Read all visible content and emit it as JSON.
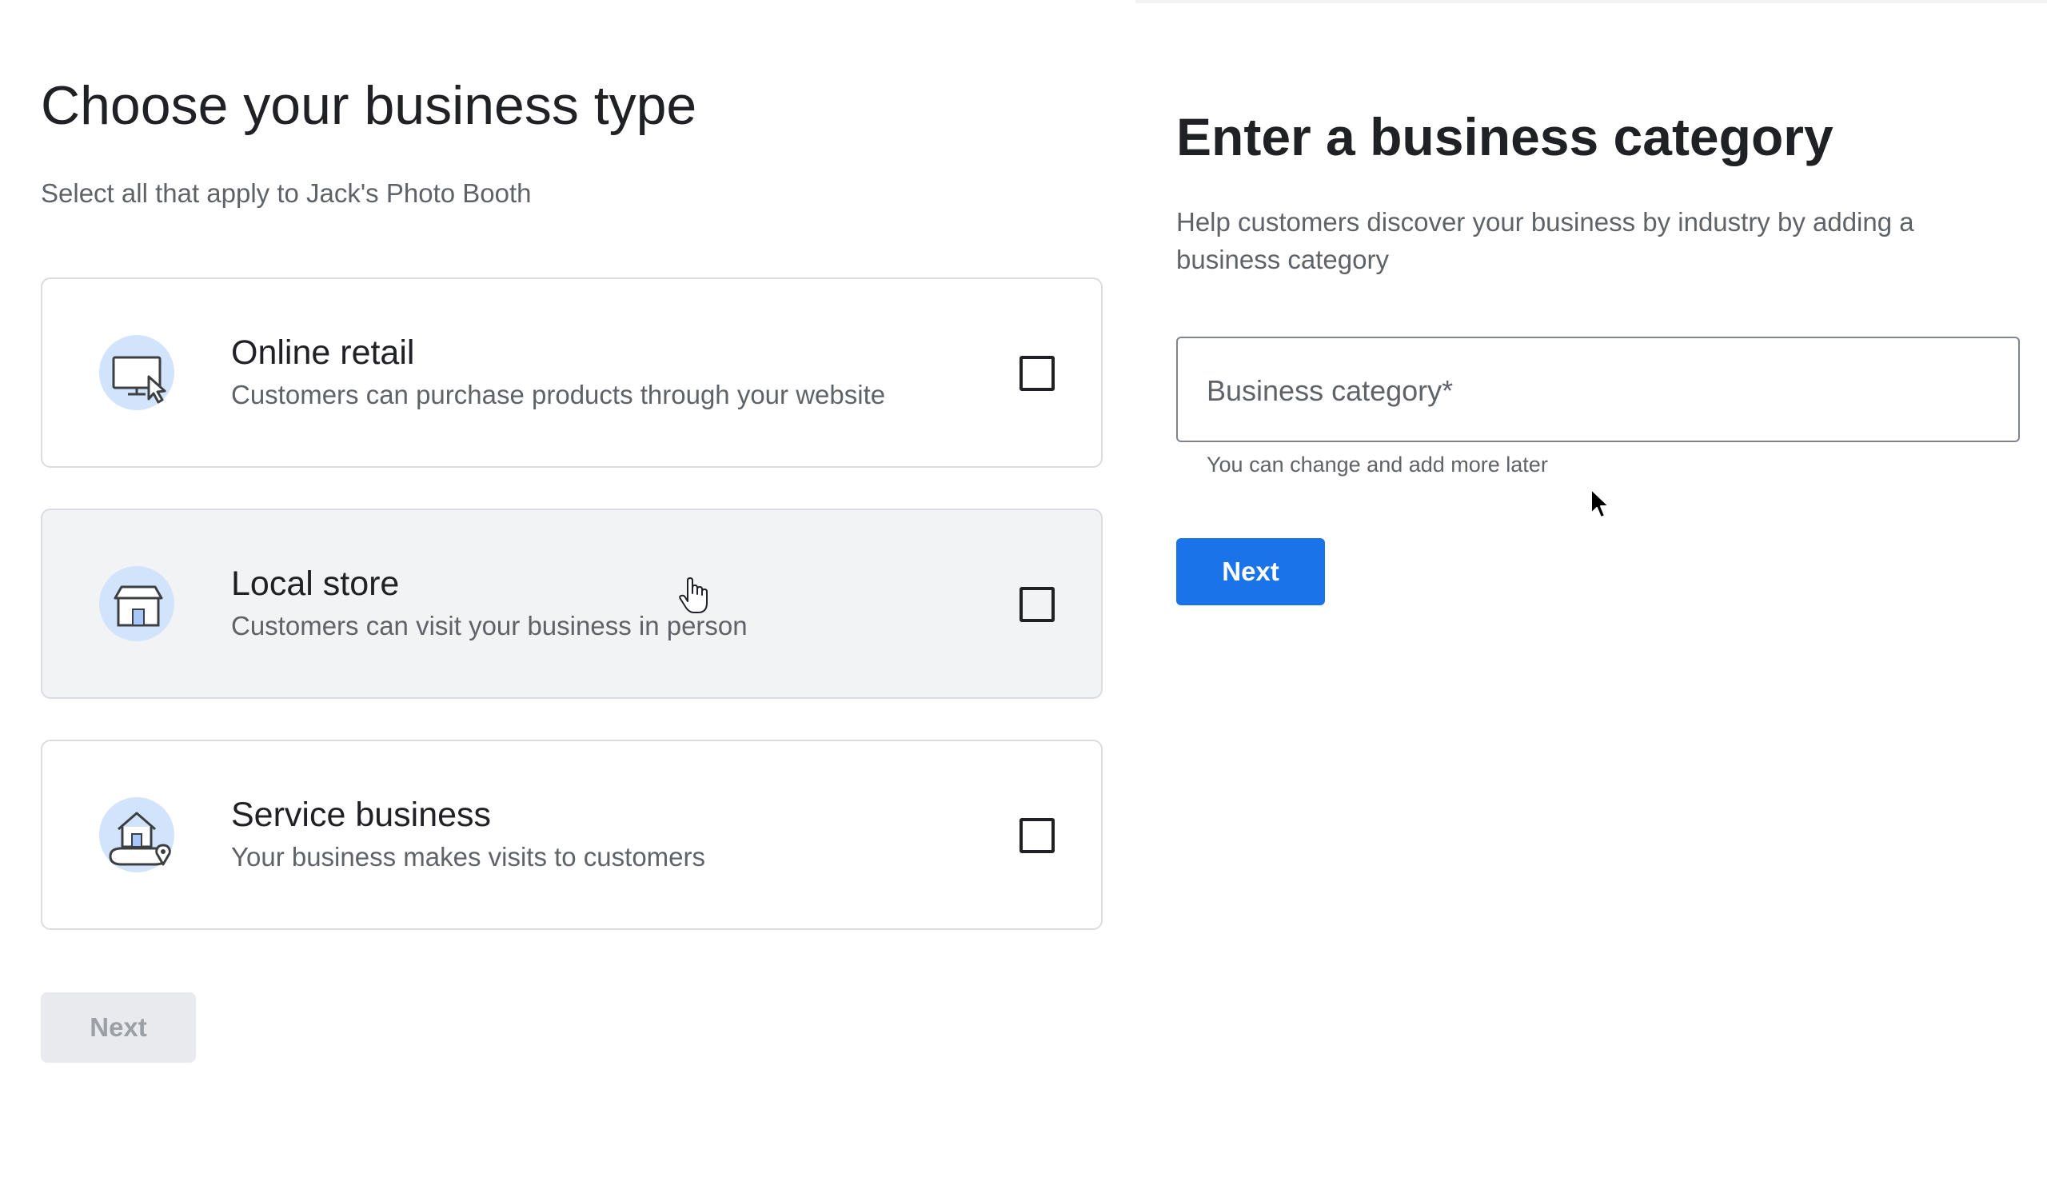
{
  "business_type": {
    "title": "Choose your business type",
    "subtitle": "Select all that apply to Jack's Photo Booth",
    "options": [
      {
        "title": "Online retail",
        "description": "Customers can purchase products through your website",
        "icon": "monitor-cursor-icon",
        "checked": false
      },
      {
        "title": "Local store",
        "description": "Customers can visit your business in person",
        "icon": "storefront-icon",
        "checked": false
      },
      {
        "title": "Service business",
        "description": "Your business makes visits to customers",
        "icon": "house-location-icon",
        "checked": false
      }
    ],
    "next_label": "Next"
  },
  "business_category": {
    "title": "Enter a business category",
    "description": "Help customers discover your business by industry by adding a business category",
    "field_placeholder": "Business category*",
    "helper_text": "You can change and add more later",
    "next_label": "Next"
  },
  "colors": {
    "accent": "#1a73e8",
    "icon_background": "#d2e3fc",
    "icon_stroke": "#3c4043",
    "hover_card": "#f1f3f4",
    "disabled_button": "#e8eaed"
  }
}
